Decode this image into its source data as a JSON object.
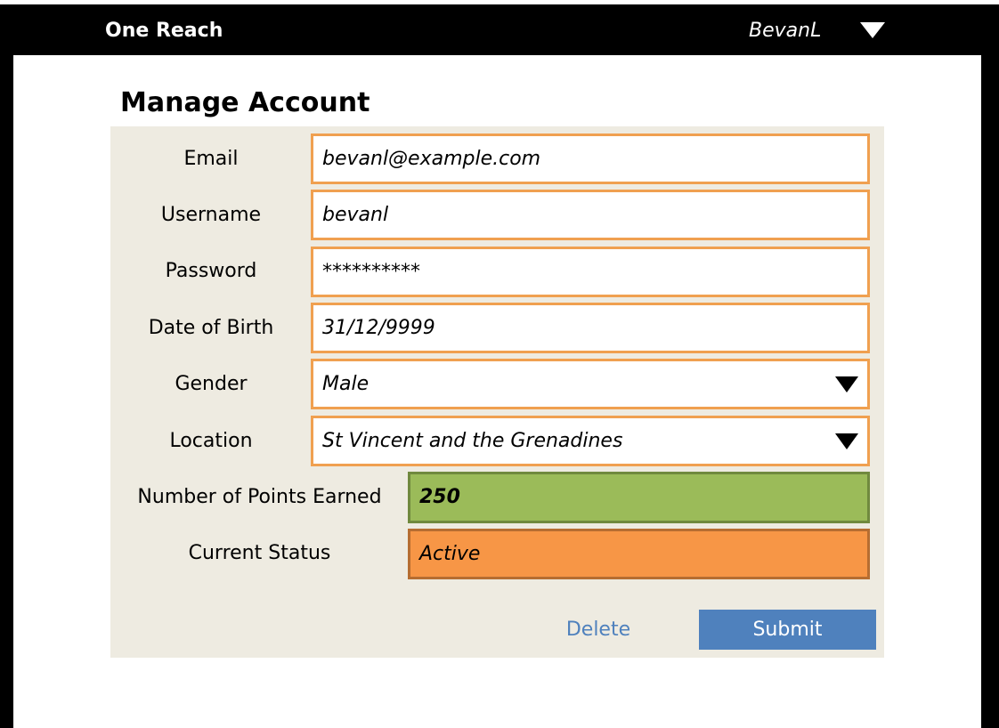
{
  "app": {
    "brand": "One Reach",
    "user_name": "BevanL",
    "user_menu_icon": "caret-down-icon"
  },
  "page": {
    "title": "Manage Account"
  },
  "form": {
    "email": {
      "label": "Email",
      "value": "bevanl@example.com"
    },
    "username": {
      "label": "Username",
      "value": "bevanl"
    },
    "password": {
      "label": "Password",
      "value": "**********"
    },
    "dob": {
      "label": "Date of Birth",
      "value": "31/12/9999"
    },
    "gender": {
      "label": "Gender",
      "value": "Male"
    },
    "location": {
      "label": "Location",
      "value": "St Vincent and the Grenadines"
    },
    "points": {
      "label": "Number of Points Earned",
      "value": "250"
    },
    "status": {
      "label": "Current Status",
      "value": "Active"
    }
  },
  "actions": {
    "delete_label": "Delete",
    "submit_label": "Submit"
  },
  "colors": {
    "input_border": "#f0a050",
    "panel_bg": "#eeebe1",
    "points_bg": "#9bbb59",
    "status_bg": "#f79646",
    "accent_blue": "#4f81bd"
  }
}
